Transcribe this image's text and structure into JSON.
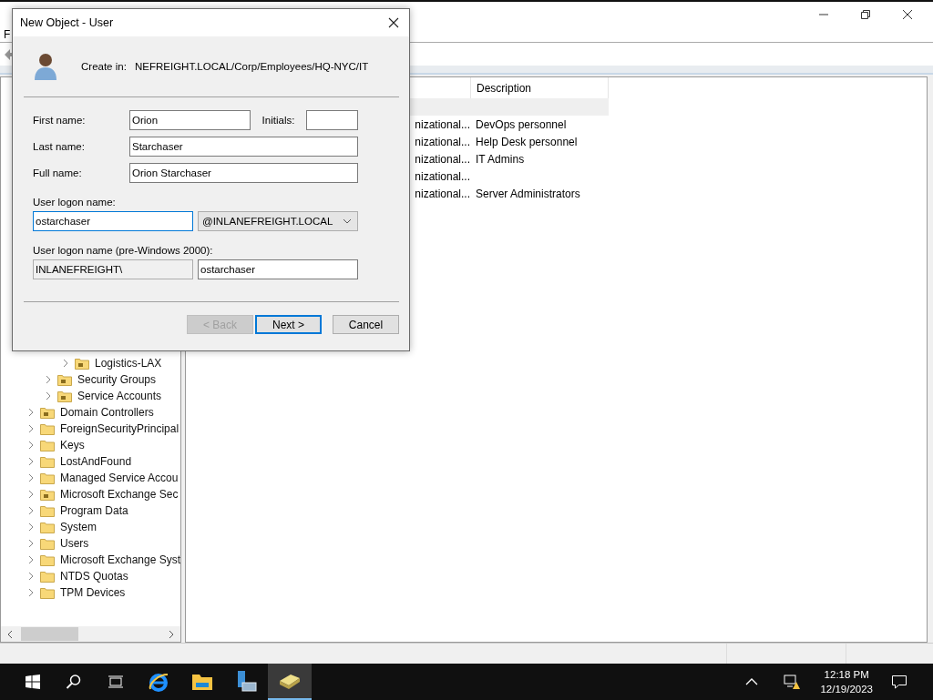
{
  "app_window": {
    "menu": [
      "F"
    ]
  },
  "tree": [
    {
      "children": [
        {
          "children": [
            {
              "children": [
                {
                  "label": "Logistics-LAX",
                  "kind": "ou",
                  "expanded": false
                }
              ]
            },
            {
              "label": "Security Groups",
              "kind": "ou",
              "expanded": false
            },
            {
              "label": "Service Accounts",
              "kind": "ou",
              "expanded": false
            }
          ]
        },
        {
          "label": "Domain Controllers",
          "kind": "ou",
          "expanded": false
        },
        {
          "label": "ForeignSecurityPrincipal",
          "kind": "container",
          "expanded": false
        },
        {
          "label": "Keys",
          "kind": "container",
          "expanded": false
        },
        {
          "label": "LostAndFound",
          "kind": "container",
          "expanded": false
        },
        {
          "label": "Managed Service Accou",
          "kind": "container",
          "expanded": false
        },
        {
          "label": "Microsoft Exchange Sec",
          "kind": "ou",
          "expanded": false
        },
        {
          "label": "Program Data",
          "kind": "container",
          "expanded": false
        },
        {
          "label": "System",
          "kind": "container",
          "expanded": false
        },
        {
          "label": "Users",
          "kind": "container",
          "expanded": false
        },
        {
          "label": "Microsoft Exchange Syst",
          "kind": "container",
          "expanded": false
        },
        {
          "label": "NTDS Quotas",
          "kind": "container",
          "expanded": false
        },
        {
          "label": "TPM Devices",
          "kind": "container",
          "expanded": false
        }
      ]
    }
  ],
  "list": {
    "columns": [
      "Description"
    ],
    "rows": [
      {
        "selected": true
      },
      {
        "column_1": "nizational...",
        "description": "DevOps personnel",
        "selected": false
      },
      {
        "column_1": "nizational...",
        "description": "Help Desk personnel",
        "selected": false
      },
      {
        "column_1": "nizational...",
        "description": "IT Admins",
        "selected": false
      },
      {
        "column_1": "nizational...",
        "selected": false
      },
      {
        "column_1": "nizational...",
        "description": "Server Administrators",
        "selected": false
      }
    ]
  },
  "dialog": {
    "title": "New Object - User",
    "create_in_label": "Create in:",
    "create_in_path": "NEFREIGHT.LOCAL/Corp/Employees/HQ-NYC/IT",
    "first_name": {
      "label": "First name:",
      "value": "Orion"
    },
    "initials": {
      "label": "Initials:"
    },
    "last_name": {
      "label": "Last name:",
      "value": "Starchaser"
    },
    "full_name": {
      "label": "Full name:",
      "value": "Orion Starchaser"
    },
    "logon": {
      "label": "User logon name:",
      "value": "ostarchaser",
      "focused": true
    },
    "domain": {
      "value": "@INLANEFREIGHT.LOCAL"
    },
    "pre2000": {
      "label": "User logon name (pre-Windows 2000):",
      "domain": "INLANEFREIGHT\\",
      "value": "ostarchaser"
    },
    "buttons": [
      {
        "label": "< Back",
        "disabled": true,
        "default": false
      },
      {
        "label": "Next >",
        "disabled": false,
        "default": true
      },
      {
        "label": "Cancel",
        "disabled": false,
        "default": false
      }
    ]
  },
  "taskbar": {
    "apps": [
      {
        "kind": "ie",
        "active": false
      },
      {
        "kind": "explorer",
        "active": false
      },
      {
        "kind": "server",
        "active": false
      },
      {
        "kind": "aduc",
        "active": true
      }
    ],
    "time": "12:18 PM",
    "date": "12/19/2023"
  }
}
